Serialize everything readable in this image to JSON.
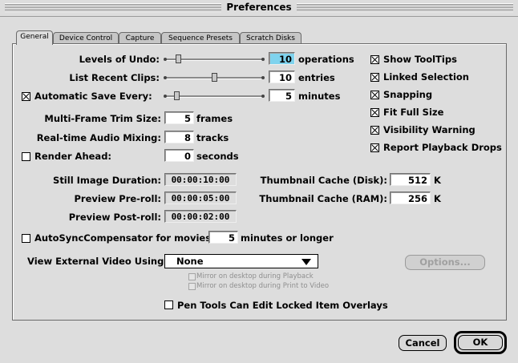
{
  "window": {
    "title": "Preferences"
  },
  "tabs": [
    {
      "label": "General"
    },
    {
      "label": "Device Control"
    },
    {
      "label": "Capture"
    },
    {
      "label": "Sequence Presets"
    },
    {
      "label": "Scratch Disks"
    }
  ],
  "general": {
    "levels_of_undo": {
      "label": "Levels of Undo:",
      "value": "10",
      "unit": "operations"
    },
    "list_recent_clips": {
      "label": "List Recent Clips:",
      "value": "10",
      "unit": "entries"
    },
    "automatic_save": {
      "label": "Automatic Save Every:",
      "value": "5",
      "unit": "minutes",
      "checked": true
    },
    "multi_frame_trim": {
      "label": "Multi-Frame Trim Size:",
      "value": "5",
      "unit": "frames"
    },
    "realtime_audio": {
      "label": "Real-time Audio Mixing:",
      "value": "8",
      "unit": "tracks"
    },
    "render_ahead": {
      "label": "Render Ahead:",
      "value": "0",
      "unit": "seconds",
      "checked": false
    },
    "still_image_duration": {
      "label": "Still Image Duration:",
      "value": "00:00:10:00"
    },
    "preview_preroll": {
      "label": "Preview Pre-roll:",
      "value": "00:00:05:00"
    },
    "preview_postroll": {
      "label": "Preview Post-roll:",
      "value": "00:00:02:00"
    },
    "thumb_cache_disk": {
      "label": "Thumbnail Cache (Disk):",
      "value": "512",
      "unit": "K"
    },
    "thumb_cache_ram": {
      "label": "Thumbnail Cache (RAM):",
      "value": "256",
      "unit": "K"
    },
    "autosync": {
      "label": "AutoSyncCompensator for movies",
      "value": "5",
      "unit": "minutes or longer",
      "checked": false
    },
    "view_external_video": {
      "label": "View External Video Using:",
      "selected": "None"
    },
    "options_button": "Options...",
    "mirror_playback": "Mirror on desktop during Playback",
    "mirror_print": "Mirror on desktop during Print to Video",
    "pen_tools": {
      "label": "Pen Tools Can Edit Locked Item Overlays",
      "checked": false
    }
  },
  "checkboxes_right": [
    {
      "label": "Show ToolTips",
      "checked": true
    },
    {
      "label": "Linked Selection",
      "checked": true
    },
    {
      "label": "Snapping",
      "checked": true
    },
    {
      "label": "Fit Full Size",
      "checked": true
    },
    {
      "label": "Visibility Warning",
      "checked": true
    },
    {
      "label": "Report Playback Drops",
      "checked": true
    }
  ],
  "sliders": {
    "undo_fraction": 0.1,
    "recent_clips_fraction": 0.5,
    "autosave_fraction": 0.08
  },
  "footer": {
    "cancel": "Cancel",
    "ok": "OK"
  },
  "colors": {
    "highlight_field": "#7fd3ee"
  }
}
